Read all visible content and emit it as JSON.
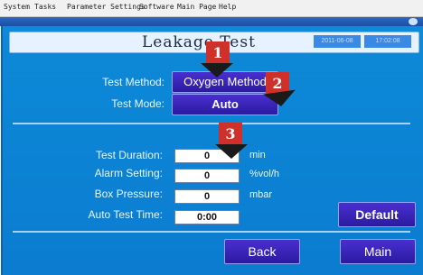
{
  "menu": {
    "items": [
      "System",
      "Tasks",
      "Parameter Settings",
      "Software",
      "Main Page",
      "Help"
    ]
  },
  "header": {
    "title": "Leakage Test",
    "date": "2011-06-08",
    "time": "17:02:08"
  },
  "form": {
    "test_method_label": "Test Method:",
    "test_method_value": "Oxygen Method",
    "test_mode_label": "Test Mode:",
    "test_mode_value": "Auto",
    "test_duration_label": "Test Duration:",
    "test_duration_value": "0",
    "test_duration_unit": "min",
    "alarm_setting_label": "Alarm Setting:",
    "alarm_setting_value": "0",
    "alarm_setting_unit": "%vol/h",
    "box_pressure_label": "Box Pressure:",
    "box_pressure_value": "0",
    "box_pressure_unit": "mbar",
    "auto_test_time_label": "Auto Test Time:",
    "auto_test_time_value": "0:00"
  },
  "buttons": {
    "default_label": "Default",
    "back_label": "Back",
    "main_label": "Main"
  },
  "annotations": {
    "badge1": "1",
    "badge2": "2",
    "badge3": "3"
  },
  "colors": {
    "panel_blue": "#0d8ad8",
    "button_purple": "#3a22b8",
    "badge_red": "#d0302a"
  }
}
